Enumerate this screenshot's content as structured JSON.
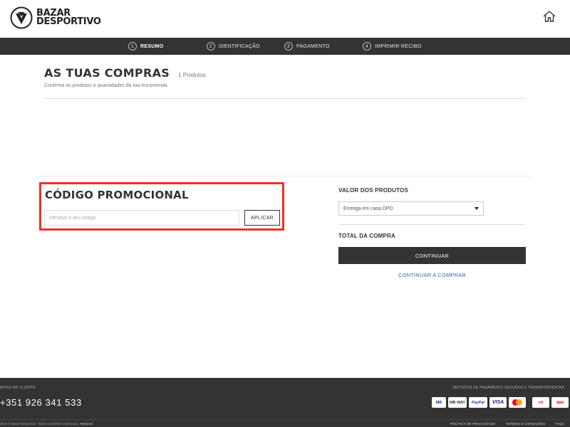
{
  "header": {
    "logo_line1": "BAZAR",
    "logo_line2": "DESPORTIVO",
    "home_icon": "home-icon"
  },
  "steps": [
    {
      "num": "1",
      "label": "RESUMO",
      "active": true
    },
    {
      "num": "2",
      "label": "IDENTIFICAÇÃO",
      "active": false
    },
    {
      "num": "3",
      "label": "PAGAMENTO",
      "active": false
    },
    {
      "num": "4",
      "label": "IMPRIMIR RECIBO",
      "active": false
    }
  ],
  "cart": {
    "title": "AS TUAS COMPRAS",
    "count": "1 Produtos",
    "subtitle": "Confirma os produtos e quantidades da tua encomenda"
  },
  "promo": {
    "title": "CÓDIGO PROMOCIONAL",
    "placeholder": "Introduz o teu código",
    "apply_label": "APLICAR",
    "highlight_color": "#ee3124"
  },
  "summary": {
    "products_value_label": "VALOR DOS PRODUTOS",
    "delivery_selected": "Entrega em casa DPD",
    "total_label": "TOTAL DA COMPRA",
    "continue_label": "CONTINUAR",
    "continue_shopping_label": "CONTINUAR A COMPRAR"
  },
  "footer": {
    "support_label": "APOIO AO CLIENTE",
    "phone": "+351 926 341 533",
    "methods_label": "MÉTODOS DE PAGAMENTO SEGUROS E TRANSPORTADORA",
    "payments": [
      "MB",
      "MB WAY",
      "PayPal",
      "VISA",
      "Mastercard",
      "ctt",
      "dpd"
    ],
    "copyright": "2019 © Bazar Desportivo. Todos os direitos reservados.",
    "credit": "Redicom",
    "links": [
      "POLÍTICA DE PRIVACIDADE",
      "TERMOS E CONDIÇÕES",
      "FAQS"
    ]
  },
  "colors": {
    "dark_bar": "#333333",
    "accent_red": "#ee3124",
    "link_blue": "#2a6ebb"
  }
}
